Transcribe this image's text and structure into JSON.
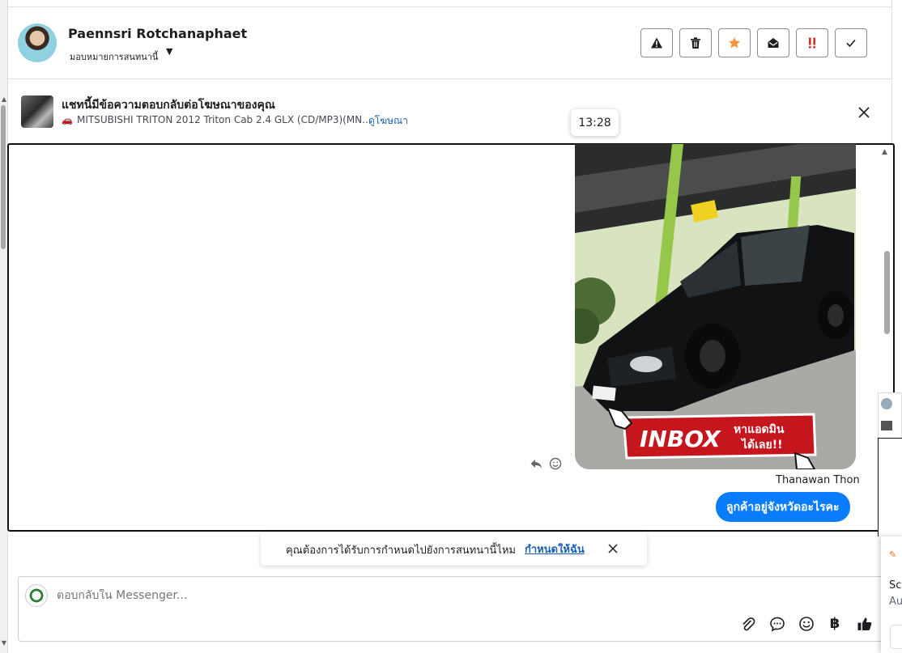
{
  "header": {
    "user_name": "Paennsri Rotchanaphaet",
    "assign_label": "มอบหมายการสนทนานี้",
    "toolbar_icons": [
      "alert-icon",
      "trash-icon",
      "star-icon",
      "envelope-open-icon",
      "priority-icon",
      "check-icon"
    ]
  },
  "ad_banner": {
    "title": "แชทนี้มีข้อความตอบกลับต่อโฆษณาของคุณ",
    "subtitle": "MITSUBISHI TRITON 2012 Triton Cab 2.4 GLX (CD/MP3)(MN...",
    "link": "ดูโฆษณา"
  },
  "chat": {
    "time_tooltip": "13:28",
    "photo": {
      "banner_main": "INBOX",
      "banner_line1": "หาแอดมิน",
      "banner_line2": "ได้เลย!!"
    },
    "sender_name": "Thanawan Thon",
    "message_text": "ลูกค้าอยู่จังหวัดอะไรคะ"
  },
  "assign_prompt": {
    "text": "คุณต้องการได้รับการกำหนดไปยังการสนทนานี้ไหม",
    "link": "กำหนดให้ฉัน"
  },
  "composer": {
    "placeholder": "ตอบกลับใน Messenger...",
    "icons": [
      "attachment-icon",
      "chat-bubble-icon",
      "emoji-icon",
      "baht-icon",
      "thumbs-up-icon"
    ],
    "baht_glyph": "฿"
  },
  "side_popup": {
    "line1": "Scr",
    "line2": "Au"
  },
  "colors": {
    "accent": "#0a7cff",
    "link": "#1a5fb4",
    "star": "#f7923a",
    "priority": "#d93025"
  }
}
